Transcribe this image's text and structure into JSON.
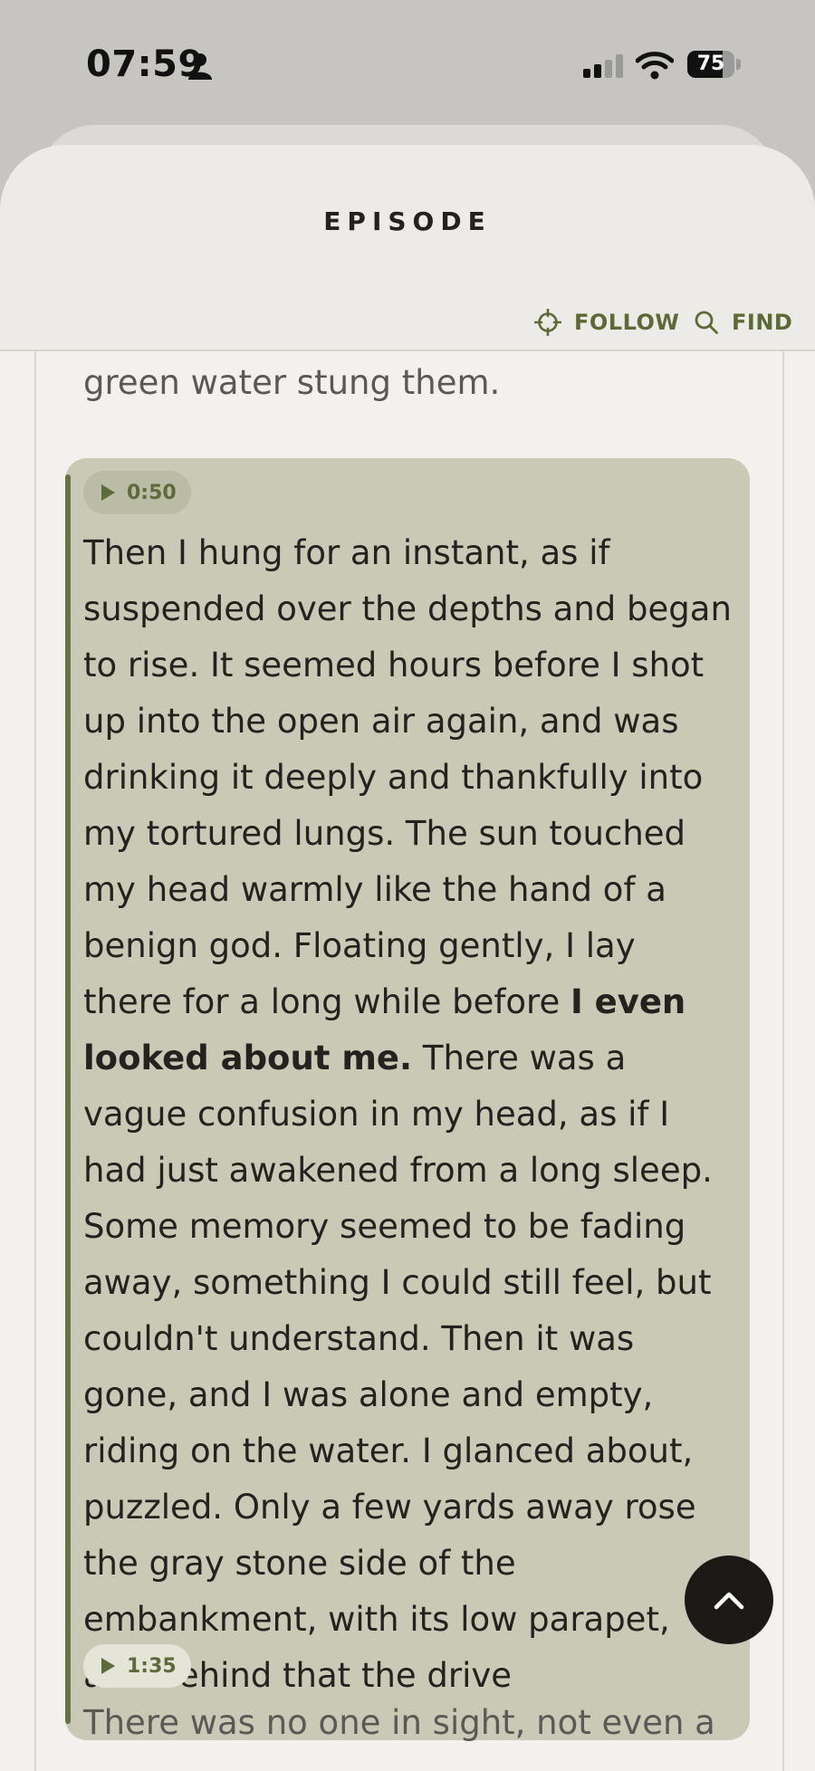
{
  "status_bar": {
    "time": "07:59",
    "battery": "75",
    "battery_level": 0.75,
    "icons": [
      "person-icon",
      "cellular-signal-icon",
      "wifi-icon",
      "battery-icon"
    ]
  },
  "header": {
    "title": "EPISODE",
    "follow_label": "FOLLOW",
    "find_label": "FIND",
    "accent_color": "#5e6a36"
  },
  "transcript": {
    "partial_text": "green water stung them.",
    "active": {
      "timestamp": "0:50",
      "text_before": "Then I hung for an instant, as if suspended over the depths and began to rise. It seemed hours before I shot up into the open air again, and was drinking it deeply and thankfully into my tortured lungs. The sun touched my head warmly like the hand of a benign god. Floating gently, I lay there for a long while before ",
      "text_bold": "I even looked about me.",
      "text_after": " There was a vague confusion in my head, as if I had just awakened from a long sleep. Some memory seemed to be fading away, something I could still feel, but couldn't understand. Then it was gone, and I was alone and empty, riding on the water. I glanced about, puzzled. Only a few yards away rose the gray stone side of the embankment, with its low parapet, and behind that the drive"
    },
    "next": {
      "timestamp": "1:35",
      "text": "There was no one in sight, not even a"
    }
  }
}
